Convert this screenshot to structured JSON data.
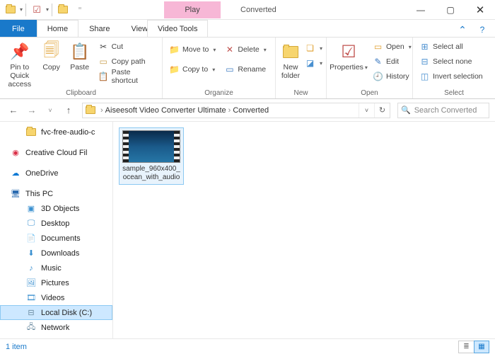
{
  "title": {
    "play": "Play",
    "window": "Converted"
  },
  "qat_tools_tab": "Video Tools",
  "tabs": {
    "file": "File",
    "home": "Home",
    "share": "Share",
    "view": "View"
  },
  "ribbon": {
    "groups": {
      "clipboard": "Clipboard",
      "organize": "Organize",
      "new": "New",
      "open": "Open",
      "select": "Select"
    },
    "pin": "Pin to Quick access",
    "copy": "Copy",
    "paste": "Paste",
    "cut": "Cut",
    "copy_path": "Copy path",
    "paste_shortcut": "Paste shortcut",
    "move_to": "Move to",
    "copy_to": "Copy to",
    "delete": "Delete",
    "rename": "Rename",
    "new_folder": "New folder",
    "properties": "Properties",
    "open": "Open",
    "edit": "Edit",
    "history": "History",
    "select_all": "Select all",
    "select_none": "Select none",
    "invert": "Invert selection"
  },
  "breadcrumb": {
    "a": "Aiseesoft Video Converter Ultimate",
    "b": "Converted"
  },
  "search_placeholder": "Search Converted",
  "nav": {
    "fvc": "fvc-free-audio-c",
    "ccf": "Creative Cloud Fil",
    "onedrive": "OneDrive",
    "thispc": "This PC",
    "obj3d": "3D Objects",
    "desktop": "Desktop",
    "documents": "Documents",
    "downloads": "Downloads",
    "music": "Music",
    "pictures": "Pictures",
    "videos": "Videos",
    "localdisk": "Local Disk (C:)",
    "network": "Network"
  },
  "file": {
    "name": "sample_960x400_ocean_with_audio"
  },
  "status": {
    "count": "1 item"
  }
}
